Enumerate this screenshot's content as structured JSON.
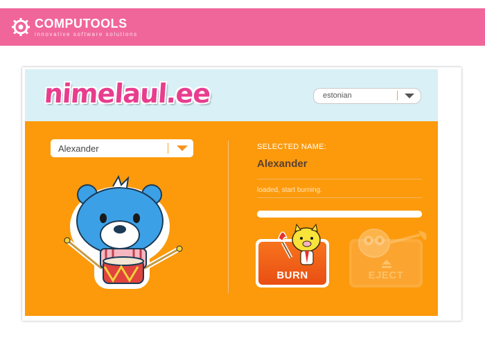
{
  "banner": {
    "brand_name": "COMPUTOOLS",
    "brand_tagline": "innovative software solutions",
    "color": "#f0669a",
    "logo_icon": "gear-icon"
  },
  "app": {
    "logo_text": "nimelaul.ee",
    "language": {
      "selected": "estonian",
      "icon": "chevron-down-icon"
    },
    "name_select": {
      "selected": "Alexander",
      "icon": "chevron-down-icon"
    },
    "selected_name_label": "SELECTED NAME:",
    "selected_name_value": "Alexander",
    "status_text": "loaded, start burning.",
    "progress": 1.0,
    "buttons": {
      "burn_label": "BURN",
      "eject_label": "EJECT"
    },
    "colors": {
      "header_bg": "#d8f0f6",
      "body_bg": "#fc9a0c",
      "burn": "#f06a18",
      "logo_pink": "#e83d8e"
    },
    "mascots": [
      "bear-drummer",
      "pig-with-torch",
      "owl-with-brush"
    ]
  }
}
